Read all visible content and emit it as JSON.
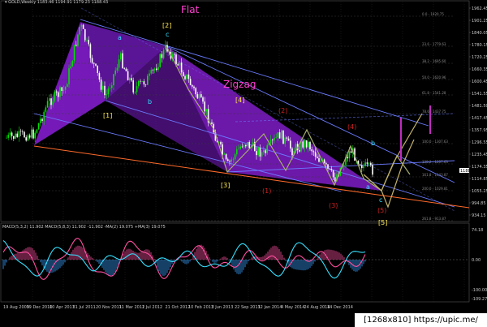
{
  "header": {
    "symbol_info": "▾ GOLD,Weekly  1183.46  1194.91  1179.23  1188.43"
  },
  "macd_header": {
    "info": "MACD(5,3,2) 11.902  MACD(5,8,3) 11.902 -11.902  -MA(2) 19.075  +MA(3) 19.075"
  },
  "labels": {
    "flat": "Flat",
    "zigzag": "Zigzag",
    "w2": "[2]",
    "w4": "[4]",
    "w1": "[1]",
    "w3": "[3]",
    "w5": "[5]",
    "a": "a",
    "b": "b",
    "c": "c",
    "iv": "(4)",
    "v": "(5)",
    "iii": "(3)",
    "i": "(1)",
    "ii": "(2)"
  },
  "watermark": "[1268x810] https://upic.me/",
  "price_axis": [
    "1962.45",
    "1901.25",
    "1840.05",
    "1780.15",
    "1720.25",
    "1660.35",
    "1600.45",
    "1541.55",
    "1481.50",
    "1417.45",
    "1357.95",
    "1296.55",
    "1235.45",
    "1174.35",
    "1114.85",
    "1055.25",
    "994.85",
    "934.15"
  ],
  "price_current": "1188.43",
  "macd_axis": [
    "74.18",
    "0.00",
    "-100.00",
    "-109.27"
  ],
  "date_axis": [
    "19 Aug 2009",
    "19 Dec 2010",
    "10 Apr 2011",
    "31 Jul 2011",
    "20 Nov 2011",
    "11 Mar 2012",
    "1 Jul 2012",
    "21 Oct 2012",
    "10 Feb 2013",
    "2 Jun 2013",
    "22 Sep 2013",
    "12 Jan 2014",
    "4 May 2014",
    "24 Aug 2014",
    "14 Dec 2014"
  ],
  "fib_levels": [
    "0.0 - 1920.75",
    "23.6 - 1779.63",
    "38.2 - 1695.60",
    "50.0 - 1620.96",
    "61.8 - 1541.28",
    "78.6 - 1437.75",
    "100.0 - 1307.63",
    "138.2 - 1207.63",
    "161.8 - 1143.87",
    "200.0 - 1029.81",
    "261.8 - 913.87"
  ],
  "colors": {
    "bull_candle": "#00e000",
    "bear_candle": "#ffffff",
    "triangle_fill": "#8a1fd8",
    "channel": "#6b7bff",
    "trendline": "#ff6a2a",
    "wave_path": "#9fa86a",
    "projection_up": "#c3b26a",
    "macd_pink": "#ff4fa0",
    "macd_cyan": "#36e0ff",
    "label_yellow": "#ffe94a",
    "label_cyan": "#36e0ff",
    "label_red": "#d02020"
  }
}
